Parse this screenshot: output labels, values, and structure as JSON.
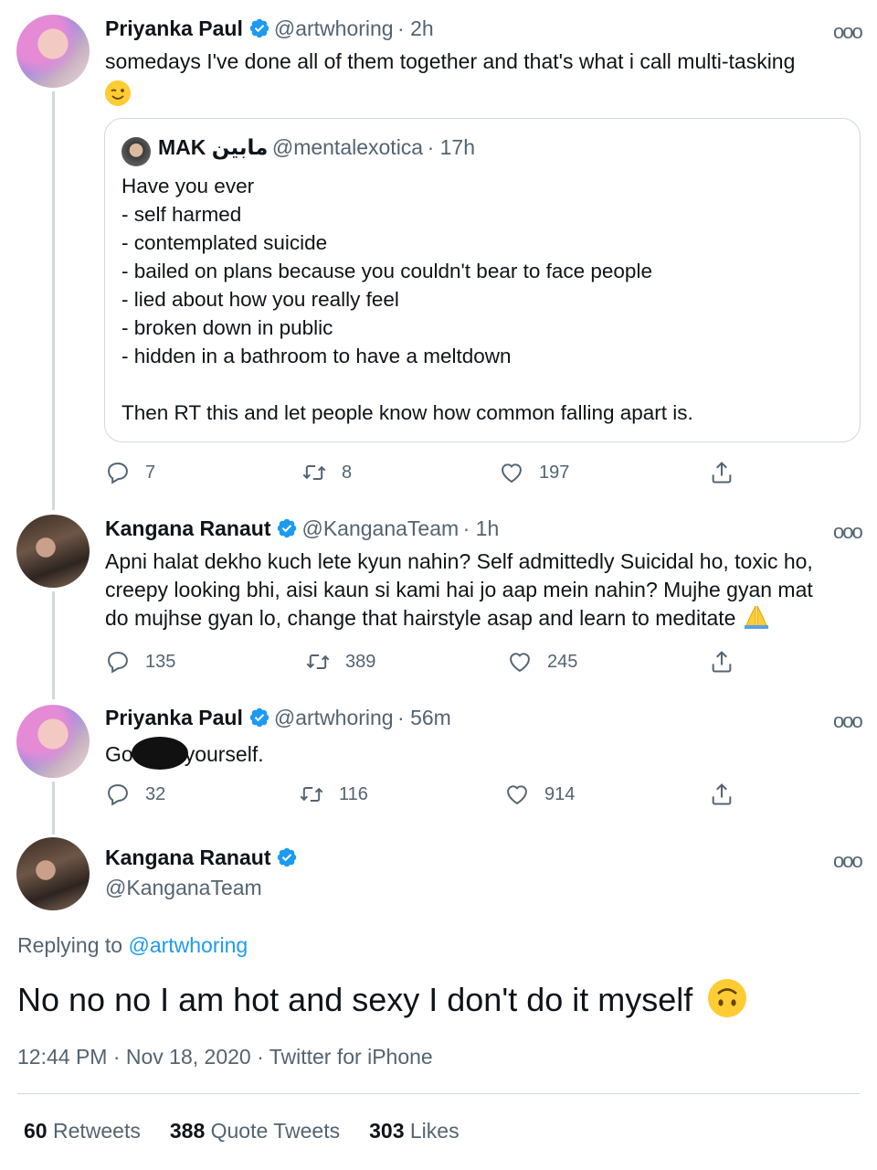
{
  "tweet1": {
    "name": "Priyanka Paul",
    "handle": "@artwhoring",
    "time": "· 2h",
    "text": "somedays I've done all of them together and that's what i call multi-tasking",
    "emoji": "wink",
    "replies": "7",
    "retweets": "8",
    "likes": "197"
  },
  "quote": {
    "name": "MAK مابين",
    "handle": "@mentalexotica",
    "time": "· 17h",
    "lines": [
      "Have you ever",
      "- self harmed",
      "- contemplated suicide",
      "- bailed on plans because you couldn't bear to face people",
      "- lied about how you really feel",
      "- broken down in public",
      "- hidden in a bathroom to have a meltdown"
    ],
    "closing": "Then RT this and let people know how common falling apart is."
  },
  "tweet2": {
    "name": "Kangana Ranaut",
    "handle": "@KanganaTeam",
    "time": "· 1h",
    "lines": [
      "Apni halat dekho kuch lete kyun nahin? Self admittedly Suicidal ho, toxic ho,",
      "creepy looking bhi, aisi kaun si kami hai jo aap mein nahin? Mujhe gyan mat",
      "do mujhse gyan lo, change that hairstyle asap and learn to meditate"
    ],
    "emoji": "folded-hands",
    "replies": "135",
    "retweets": "389",
    "likes": "245"
  },
  "tweet3": {
    "name": "Priyanka Paul",
    "handle": "@artwhoring",
    "time": "· 56m",
    "text_before": "Go",
    "text_after": "yourself.",
    "replies": "32",
    "retweets": "116",
    "likes": "914"
  },
  "main": {
    "name": "Kangana Ranaut",
    "handle": "@KanganaTeam",
    "replying_prefix": "Replying to",
    "replying_to": "@artwhoring",
    "text": "No no no I am hot and sexy I don't do it myself",
    "emoji": "upside-down-face",
    "timestamp": "12:44 PM · Nov 18, 2020 · Twitter for iPhone",
    "retweets_count": "60",
    "retweets_label": "Retweets",
    "quotes_count": "388",
    "quotes_label": "Quote Tweets",
    "likes_count": "303",
    "likes_label": "Likes"
  },
  "more_glyph": "ooo",
  "colors": {
    "verified": "#1d9bf0",
    "link": "#1d9bf0",
    "secondary": "#536471",
    "border": "#cfd9de"
  }
}
